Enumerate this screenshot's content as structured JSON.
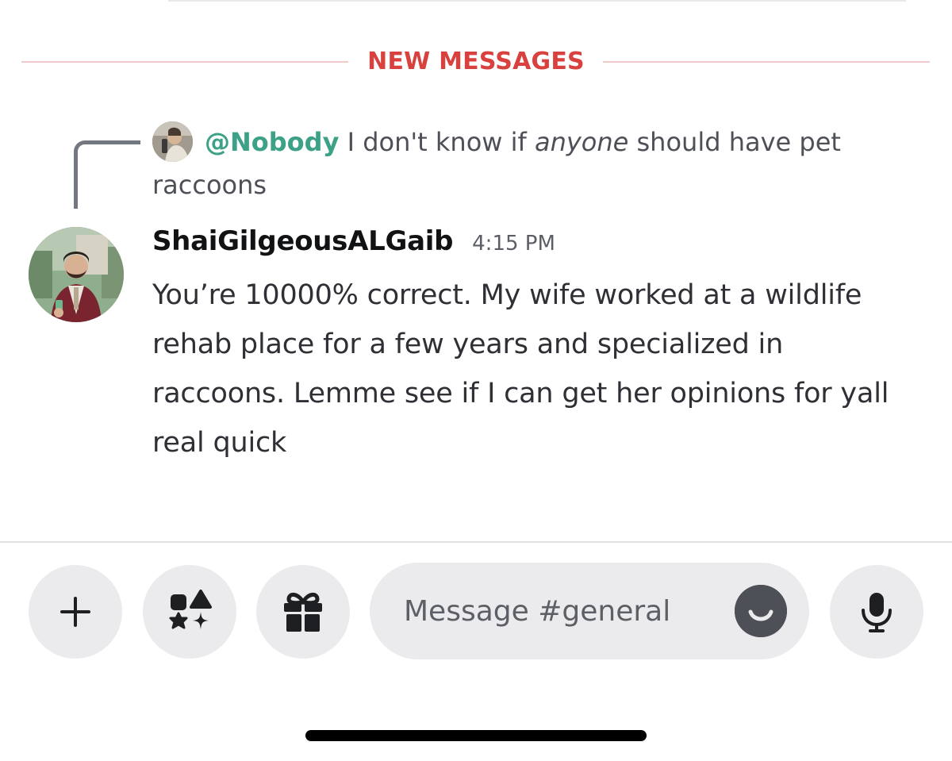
{
  "new_messages_divider": {
    "label": "NEW MESSAGES",
    "color": "#d9413f"
  },
  "reply": {
    "mention": "@Nobody",
    "text_before": "I don't know if",
    "text_emphasis": "anyone",
    "text_after": "should have pet raccoons"
  },
  "message": {
    "username": "ShaiGilgeousALGaib",
    "timestamp": "4:15 PM",
    "body": "You’re 10000% correct. My wife worked at a wildlife rehab place for a few years and specialized in raccoons. Lemme see if I can get her opinions for yall real quick"
  },
  "composer": {
    "placeholder": "Message #general",
    "icons": [
      "plus-icon",
      "apps-icon",
      "gift-icon",
      "emoji-icon",
      "mic-icon"
    ]
  },
  "colors": {
    "mention": "#3da188",
    "button_bg": "#ebebed",
    "icon": "#1e1f22"
  }
}
